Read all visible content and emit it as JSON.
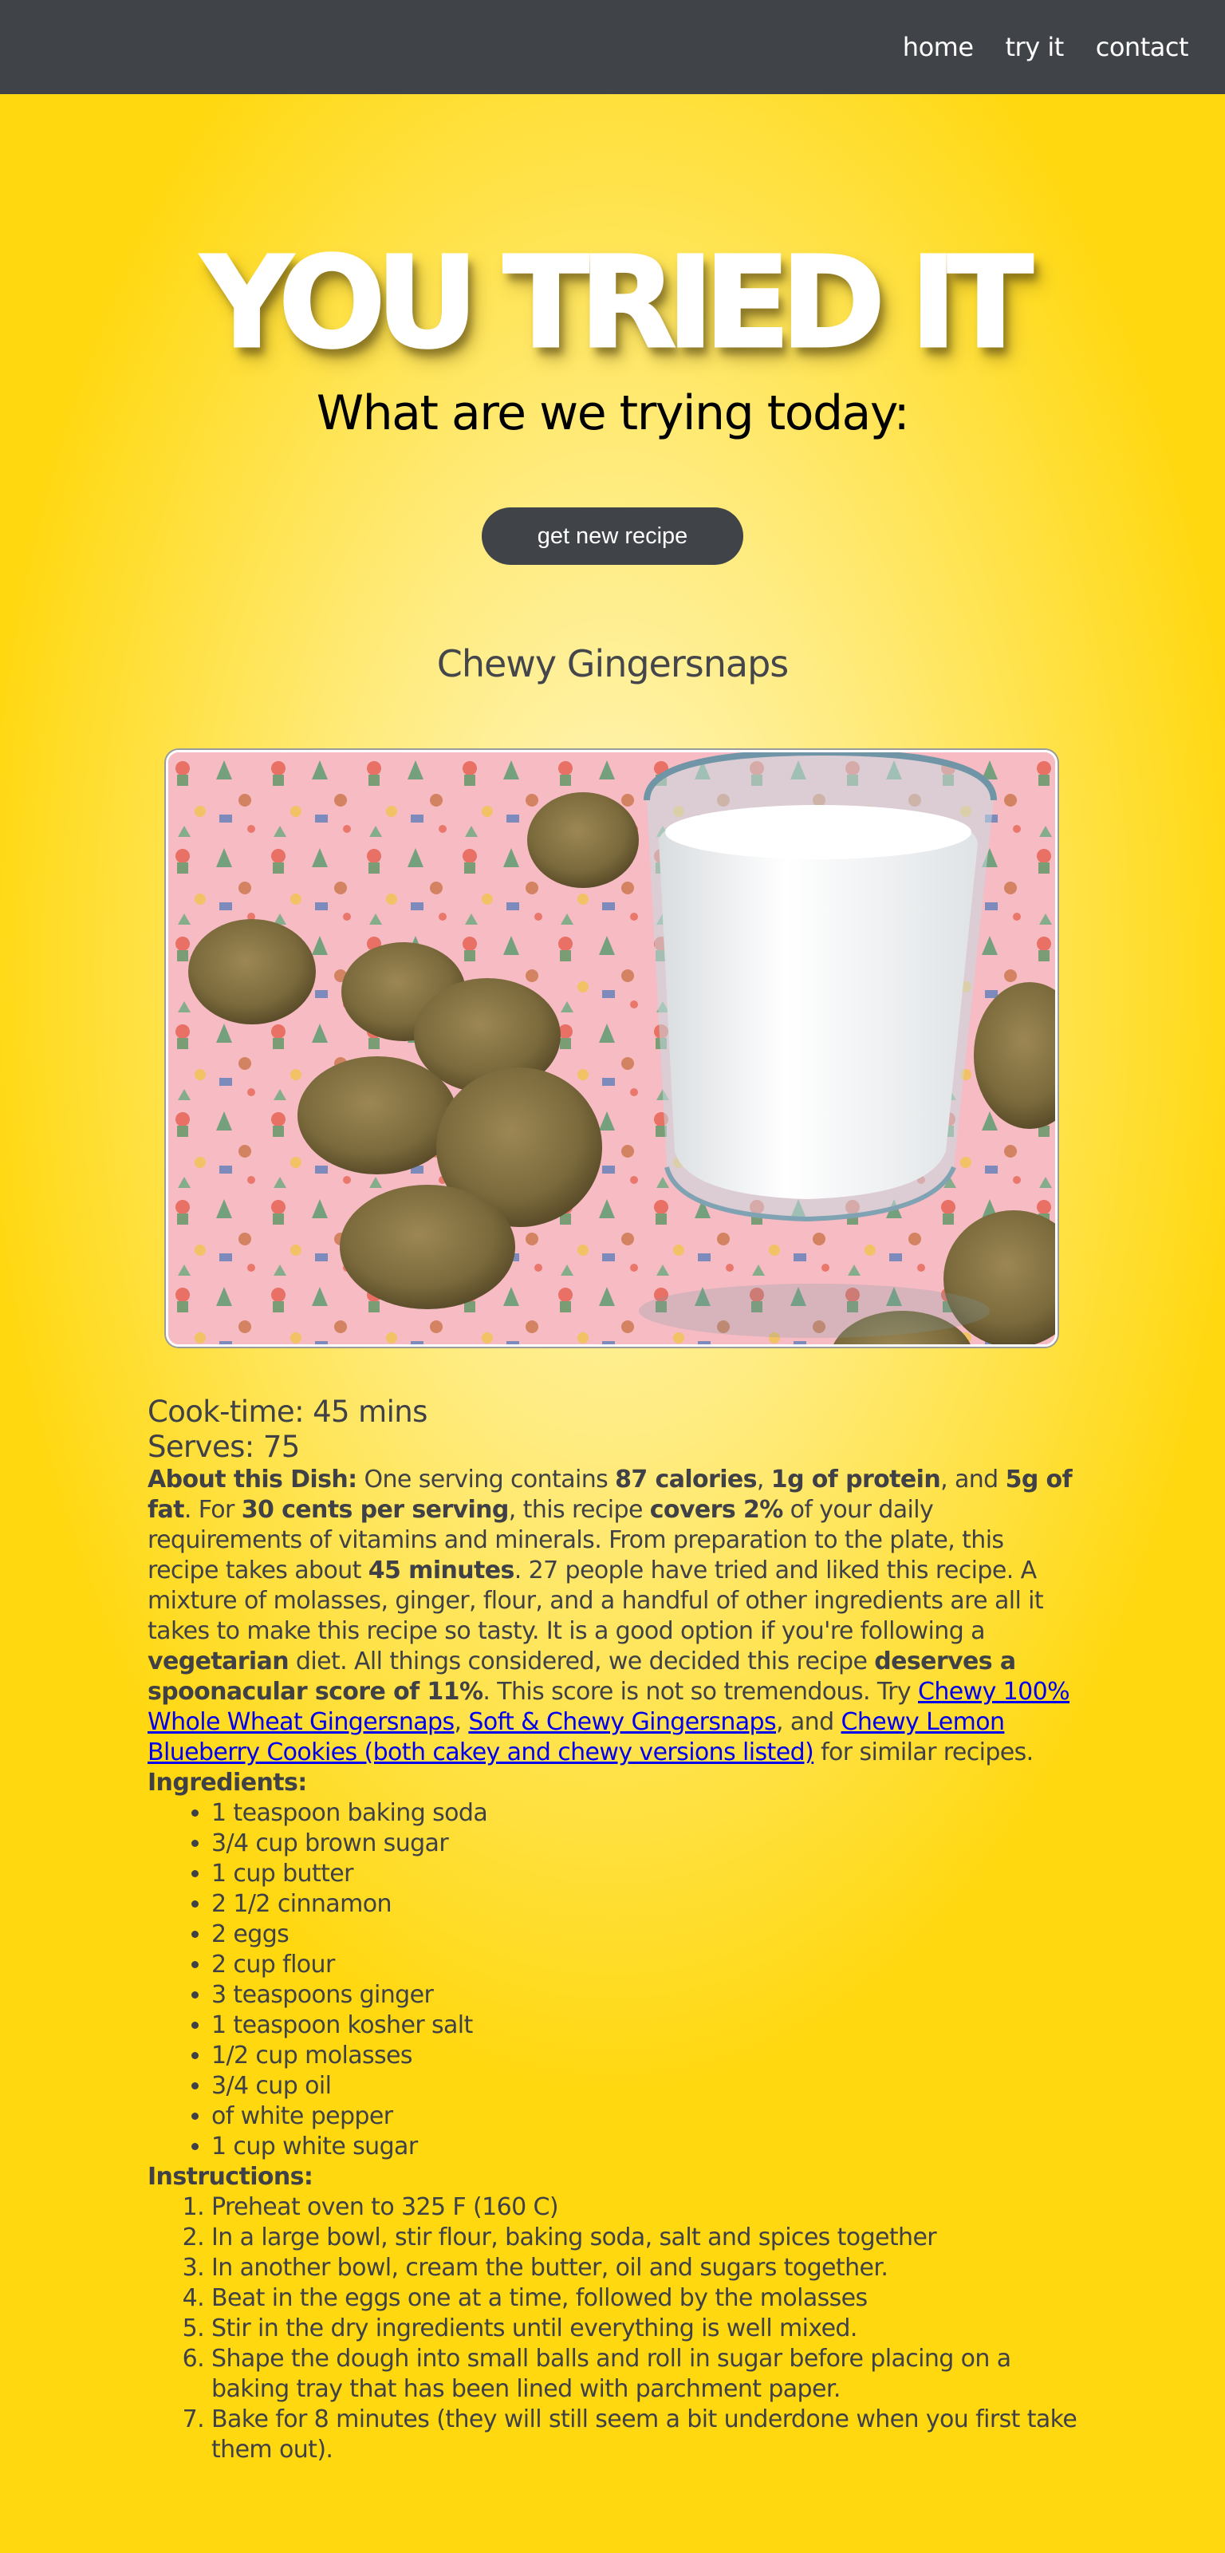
{
  "nav": {
    "home": "home",
    "try_it": "try it",
    "contact": "contact"
  },
  "hero": {
    "title": "YOU TRIED IT",
    "subtitle": "What are we trying today:",
    "button": "get new recipe"
  },
  "recipe": {
    "title": "Chewy Gingersnaps",
    "cook_time": "Cook-time: 45 mins",
    "serves": "Serves: 75",
    "about": {
      "label": "About this Dish:",
      "t1": " One serving contains ",
      "b1": "87 calories",
      "t2": ", ",
      "b2": "1g of protein",
      "t3": ", and ",
      "b3": "5g of fat",
      "t4": ". For ",
      "b4": "30 cents per serving",
      "t5": ", this recipe ",
      "b5": "covers 2%",
      "t6": " of your daily requirements of vitamins and minerals. From preparation to the plate, this recipe takes about ",
      "b6": "45 minutes",
      "t7": ". 27 people have tried and liked this recipe. A mixture of molasses, ginger, flour, and a handful of other ingredients are all it takes to make this recipe so tasty. It is a good option if you're following a ",
      "b7": "vegetarian",
      "t8": " diet. All things considered, we decided this recipe ",
      "b8": "deserves a spoonacular score of 11%",
      "t9": ". This score is not so tremendous. Try ",
      "link1": "Chewy 100% Whole Wheat Gingersnaps",
      "t10": ", ",
      "link2": "Soft & Chewy Gingersnaps",
      "t11": ", and ",
      "link3": "Chewy Lemon Blueberry Cookies (both cakey and chewy versions listed)",
      "t12": " for similar recipes."
    },
    "ingredients_label": "Ingredients:",
    "ingredients": [
      "1 teaspoon baking soda",
      "3/4 cup brown sugar",
      "1 cup butter",
      "2 1/2 cinnamon",
      "2 eggs",
      "2 cup flour",
      "3 teaspoons ginger",
      "1 teaspoon kosher salt",
      "1/2 cup molasses",
      "3/4 cup oil",
      "of white pepper",
      "1 cup white sugar"
    ],
    "instructions_label": "Instructions:",
    "instructions": [
      "Preheat oven to 325 F (160 C)",
      "In a large bowl, stir flour, baking soda, salt and spices together",
      "In another bowl, cream the butter, oil and sugars together.",
      "Beat in the eggs one at a time, followed by the molasses",
      "Stir in the dry ingredients until everything is well mixed.",
      "Shape the dough into small balls and roll in sugar before placing on a baking tray that has been lined with parchment paper.",
      "Bake for 8 minutes (they will still seem a bit underdone when you first take them out)."
    ]
  },
  "colors": {
    "navbar": "#404347",
    "background_center": "#fff6c2",
    "background_edge": "#ffd810",
    "button": "#404347",
    "link": "#0000ee"
  }
}
